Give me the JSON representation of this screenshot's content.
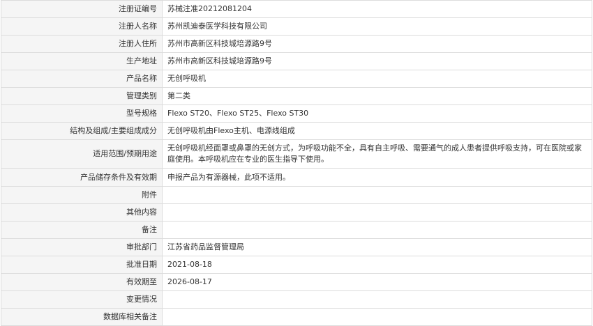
{
  "rows": [
    {
      "label": "注册证编号",
      "value": "苏械注准20212081204"
    },
    {
      "label": "注册人名称",
      "value": "苏州凯迪泰医学科技有限公司"
    },
    {
      "label": "注册人住所",
      "value": "苏州市高新区科技城培源路9号"
    },
    {
      "label": "生产地址",
      "value": "苏州市高新区科技城培源路9号"
    },
    {
      "label": "产品名称",
      "value": "无创呼吸机"
    },
    {
      "label": "管理类别",
      "value": "第二类"
    },
    {
      "label": "型号规格",
      "value": "Flexo ST20、Flexo ST25、Flexo ST30"
    },
    {
      "label": "结构及组成/主要组成成分",
      "value": "无创呼吸机由Flexo主机、电源线组成"
    },
    {
      "label": "适用范围/预期用途",
      "value": "无创呼吸机经面罩或鼻罩的无创方式，为呼吸功能不全，具有自主呼吸、需要通气的成人患者提供呼吸支持，可在医院或家庭使用。本呼吸机应在专业的医生指导下使用。"
    },
    {
      "label": "产品储存条件及有效期",
      "value": "申报产品为有源器械，此项不适用。"
    },
    {
      "label": "附件",
      "value": ""
    },
    {
      "label": "其他内容",
      "value": ""
    },
    {
      "label": "备注",
      "value": ""
    },
    {
      "label": "审批部门",
      "value": "江苏省药品监督管理局"
    },
    {
      "label": "批准日期",
      "value": "2021-08-18"
    },
    {
      "label": "有效期至",
      "value": "2026-08-17"
    },
    {
      "label": "变更情况",
      "value": ""
    },
    {
      "label": "数据库相关备注",
      "value": ""
    }
  ]
}
